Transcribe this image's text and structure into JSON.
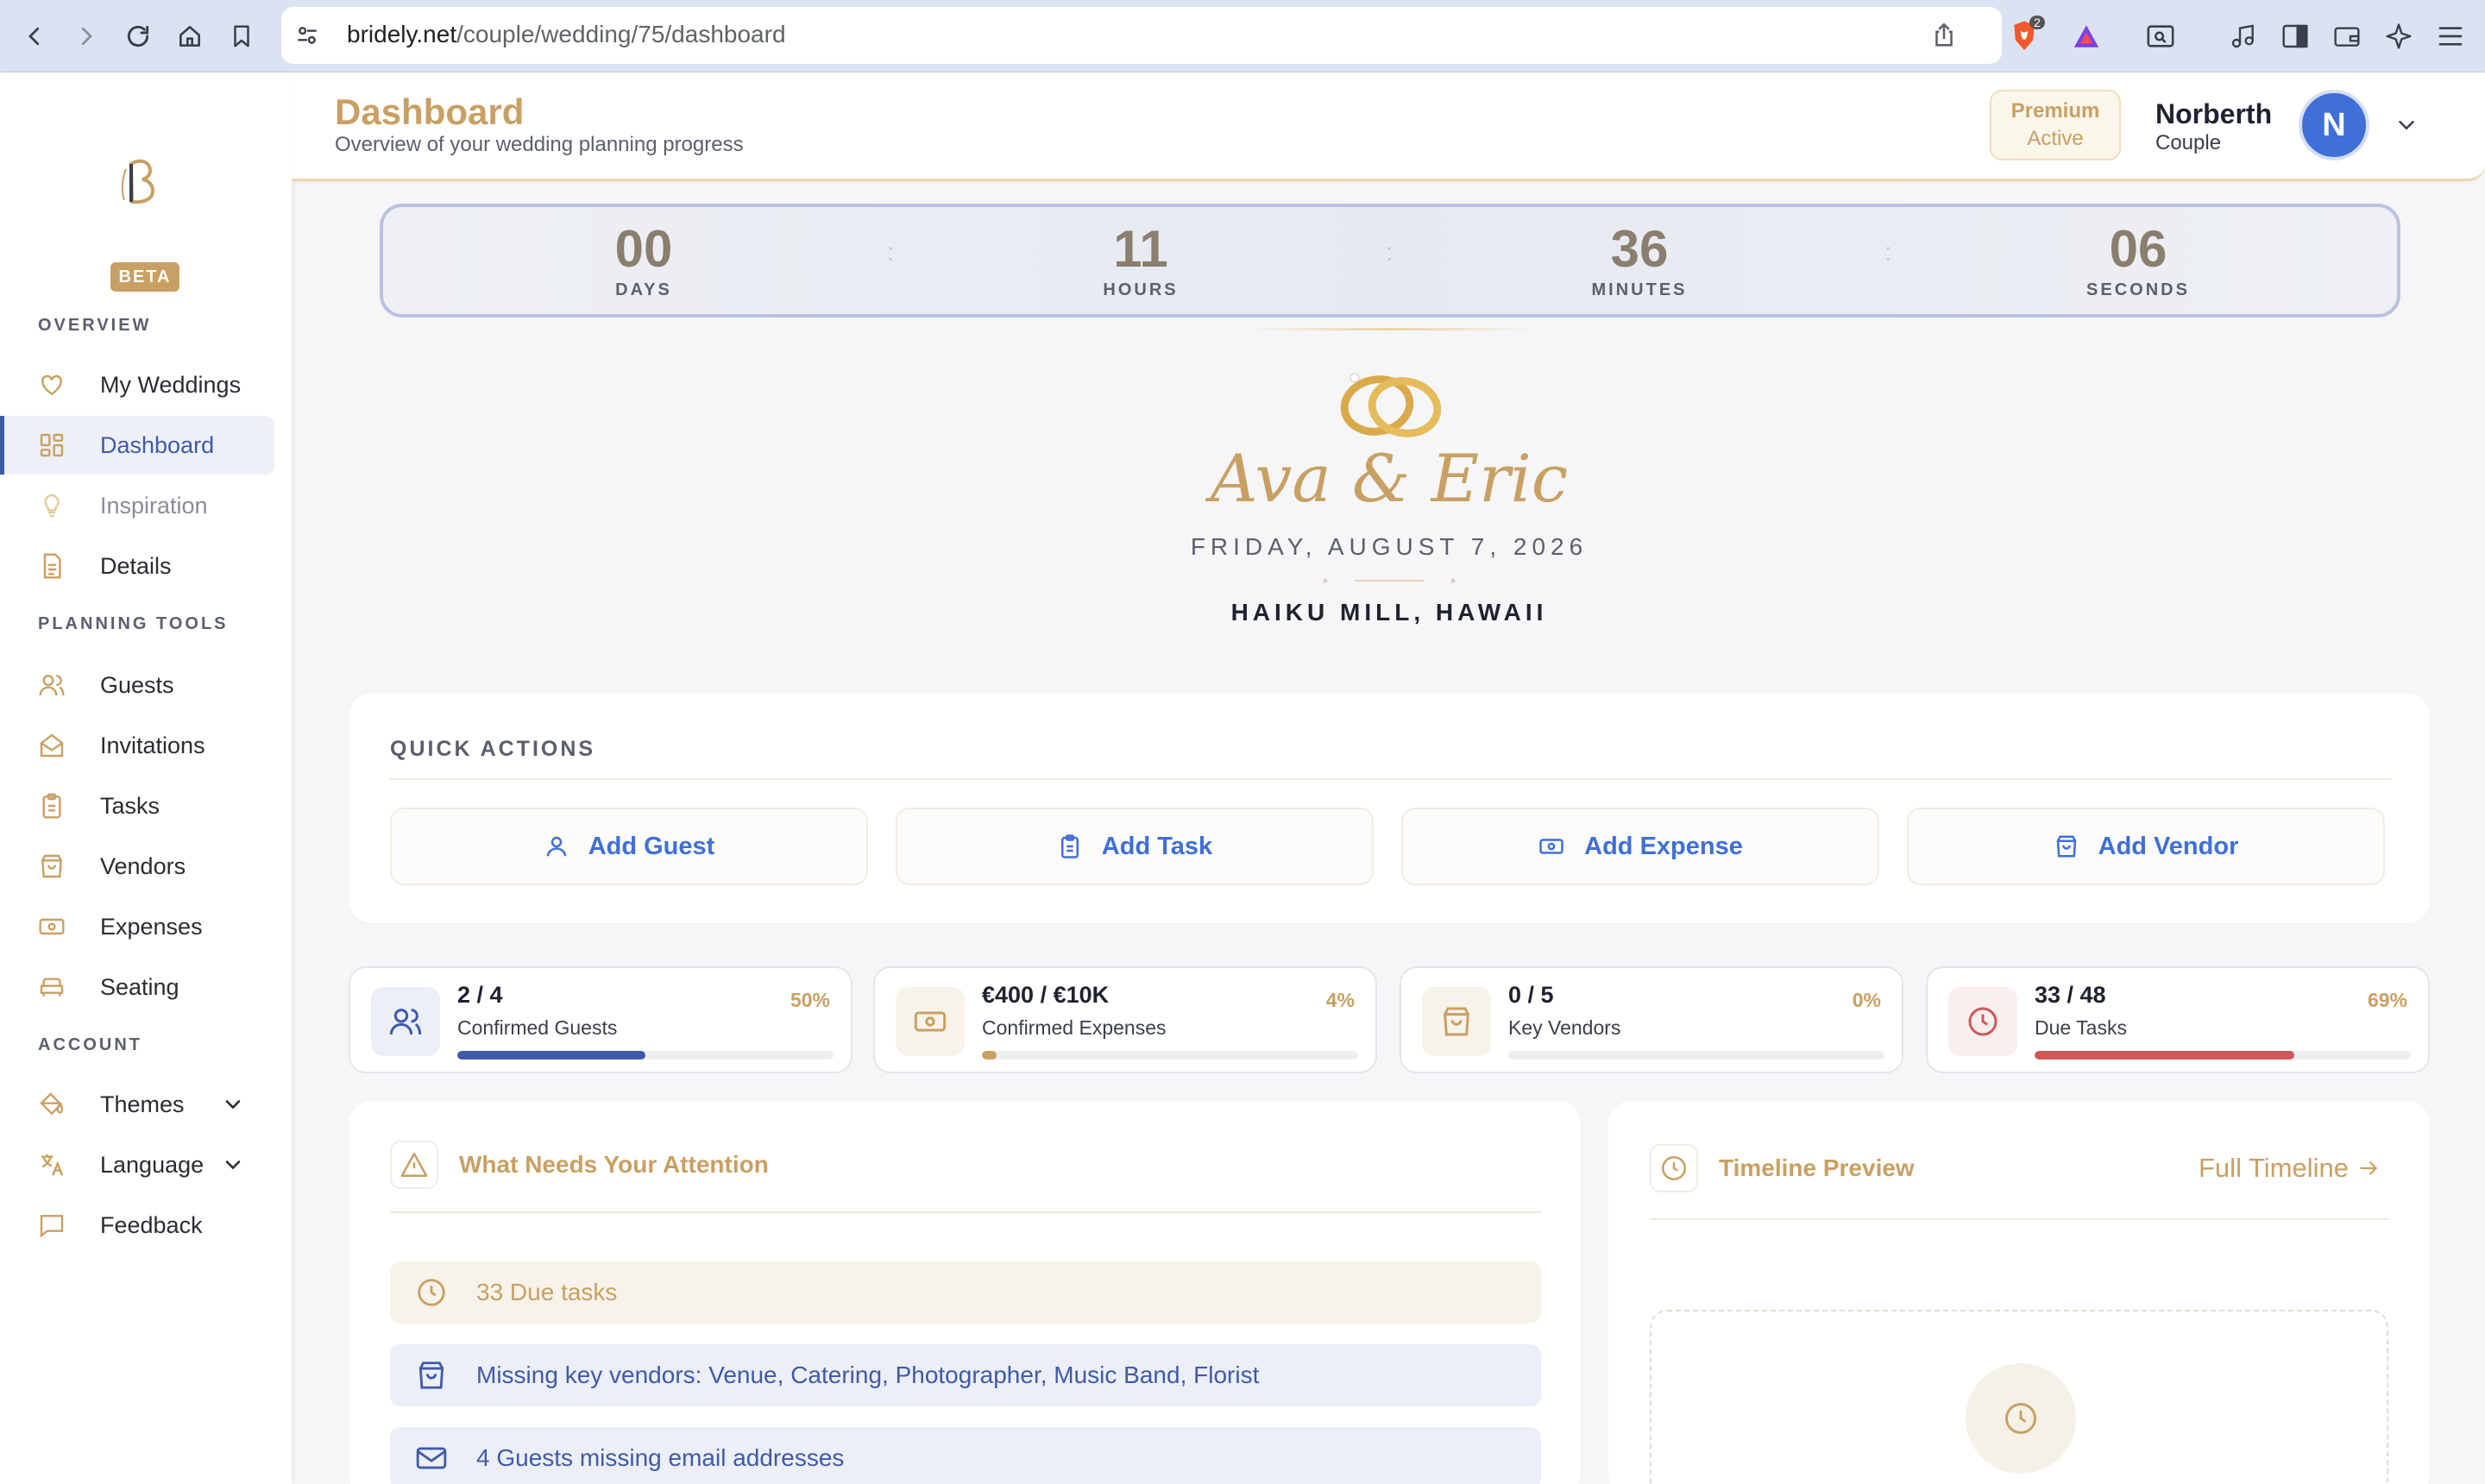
{
  "browser": {
    "url_host": "bridely.net",
    "url_path": "/couple/wedding/75/dashboard",
    "extension_badge": "2"
  },
  "sidebar": {
    "beta": "BETA",
    "sections": {
      "overview": "OVERVIEW",
      "planning": "PLANNING TOOLS",
      "account": "ACCOUNT"
    },
    "items": {
      "my_weddings": "My Weddings",
      "dashboard": "Dashboard",
      "inspiration": "Inspiration",
      "details": "Details",
      "guests": "Guests",
      "invitations": "Invitations",
      "tasks": "Tasks",
      "vendors": "Vendors",
      "expenses": "Expenses",
      "seating": "Seating",
      "themes": "Themes",
      "language": "Language",
      "feedback": "Feedback"
    }
  },
  "header": {
    "title": "Dashboard",
    "subtitle": "Overview of your wedding planning progress",
    "premium_line1": "Premium",
    "premium_line2": "Active",
    "user_name": "Norberth",
    "user_role": "Couple",
    "avatar_initial": "N"
  },
  "countdown": {
    "days": "00",
    "days_label": "DAYS",
    "hours": "11",
    "hours_label": "HOURS",
    "minutes": "36",
    "minutes_label": "MINUTES",
    "seconds": "06",
    "seconds_label": "SECONDS",
    "separator": ":"
  },
  "wedding": {
    "couple": "Ava & Eric",
    "date": "FRIDAY, AUGUST 7, 2026",
    "venue": "HAIKU MILL, HAWAII"
  },
  "quick_actions": {
    "title": "QUICK ACTIONS",
    "add_guest": "Add Guest",
    "add_task": "Add Task",
    "add_expense": "Add Expense",
    "add_vendor": "Add Vendor"
  },
  "stats": [
    {
      "value": "2 / 4",
      "label": "Confirmed Guests",
      "percent": "50%",
      "progress": 0.5,
      "color": "#3f5aa8"
    },
    {
      "value": "€400 / €10K",
      "label": "Confirmed Expenses",
      "percent": "4%",
      "progress": 0.04,
      "color": "#c9a063"
    },
    {
      "value": "0 / 5",
      "label": "Key Vendors",
      "percent": "0%",
      "progress": 0,
      "color": "#c9a063"
    },
    {
      "value": "33 / 48",
      "label": "Due Tasks",
      "percent": "69%",
      "progress": 0.69,
      "color": "#d05858"
    }
  ],
  "attention": {
    "title": "What Needs Your Attention",
    "alerts": [
      "33 Due tasks",
      "Missing key vendors: Venue, Catering, Photographer, Music Band, Florist",
      "4 Guests missing email addresses"
    ]
  },
  "timeline": {
    "title": "Timeline Preview",
    "link": "Full Timeline"
  },
  "colors": {
    "gold": "#c9a063",
    "navy": "#3f5aa8",
    "blue": "#3f6fd8",
    "red": "#d05858"
  }
}
